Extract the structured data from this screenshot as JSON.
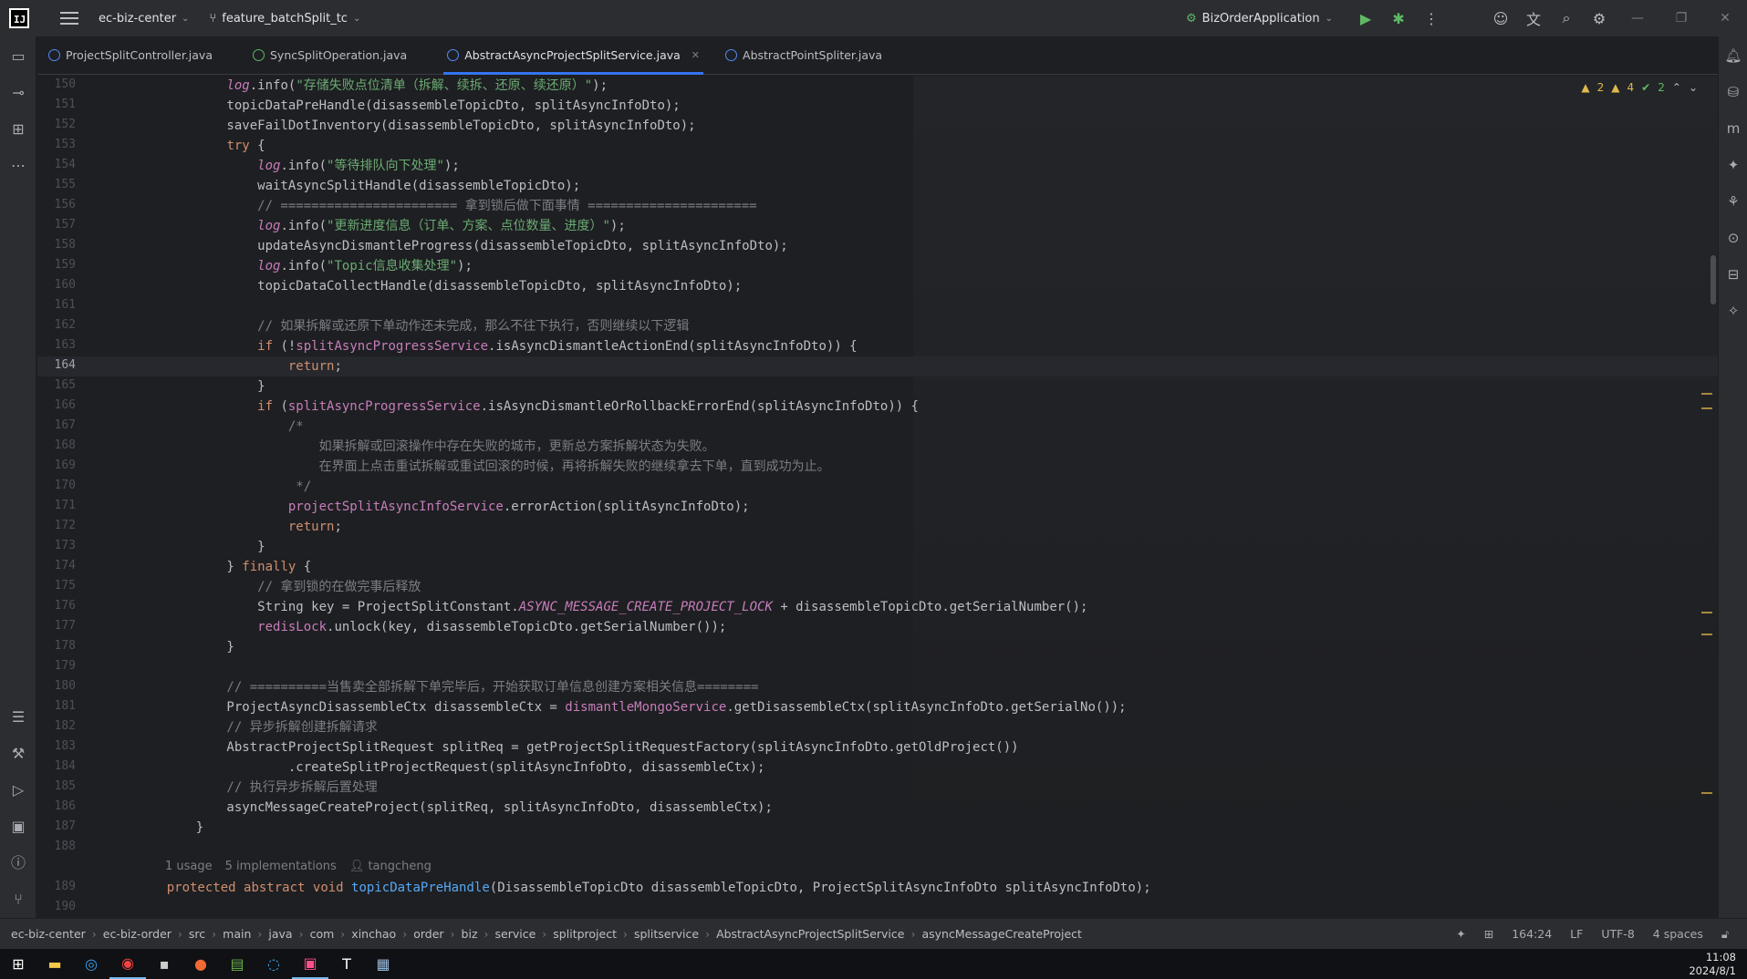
{
  "titlebar": {
    "logo": "IJ",
    "project": "ec-biz-center",
    "branch": "feature_batchSplit_tc",
    "run_config": "BizOrderApplication"
  },
  "tabs": [
    {
      "label": "ProjectSplitController.java",
      "icon": "class-icon"
    },
    {
      "label": "SyncSplitOperation.java",
      "icon": "interface-icon"
    },
    {
      "label": "AbstractAsyncProjectSplitService.java",
      "icon": "class-icon",
      "active": true
    },
    {
      "label": "AbstractPointSpliter.java",
      "icon": "class-icon"
    }
  ],
  "inspections": {
    "warnings": "2",
    "weak_warnings": "4",
    "ok": "2"
  },
  "editor": {
    "current_line": "164",
    "lines": [
      {
        "n": "150",
        "text": "        log.info(\"存储失败点位清单（拆解、续拆、还原、续还原）\");"
      },
      {
        "n": "151",
        "text": "        topicDataPreHandle(disassembleTopicDto, splitAsyncInfoDto);"
      },
      {
        "n": "152",
        "text": "        saveFailDotInventory(disassembleTopicDto, splitAsyncInfoDto);"
      },
      {
        "n": "153",
        "text": "        try {"
      },
      {
        "n": "154",
        "text": "            log.info(\"等待排队向下处理\");"
      },
      {
        "n": "155",
        "text": "            waitAsyncSplitHandle(disassembleTopicDto);"
      },
      {
        "n": "156",
        "text": "            // ======================= 拿到锁后做下面事情 ======================"
      },
      {
        "n": "157",
        "text": "            log.info(\"更新进度信息（订单、方案、点位数量、进度）\");"
      },
      {
        "n": "158",
        "text": "            updateAsyncDismantleProgress(disassembleTopicDto, splitAsyncInfoDto);"
      },
      {
        "n": "159",
        "text": "            log.info(\"Topic信息收集处理\");"
      },
      {
        "n": "160",
        "text": "            topicDataCollectHandle(disassembleTopicDto, splitAsyncInfoDto);"
      },
      {
        "n": "161",
        "text": ""
      },
      {
        "n": "162",
        "text": "            // 如果拆解或还原下单动作还未完成，那么不往下执行，否则继续以下逻辑"
      },
      {
        "n": "163",
        "text": "            if (!splitAsyncProgressService.isAsyncDismantleActionEnd(splitAsyncInfoDto)) {"
      },
      {
        "n": "164",
        "text": "                return;"
      },
      {
        "n": "165",
        "text": "            }"
      },
      {
        "n": "166",
        "text": "            if (splitAsyncProgressService.isAsyncDismantleOrRollbackErrorEnd(splitAsyncInfoDto)) {"
      },
      {
        "n": "167",
        "text": "                /*"
      },
      {
        "n": "168",
        "text": "                    如果拆解或回滚操作中存在失败的城市，更新总方案拆解状态为失败。"
      },
      {
        "n": "169",
        "text": "                    在界面上点击重试拆解或重试回滚的时候，再将拆解失败的继续拿去下单，直到成功为止。"
      },
      {
        "n": "170",
        "text": "                 */"
      },
      {
        "n": "171",
        "text": "                projectSplitAsyncInfoService.errorAction(splitAsyncInfoDto);"
      },
      {
        "n": "172",
        "text": "                return;"
      },
      {
        "n": "173",
        "text": "            }"
      },
      {
        "n": "174",
        "text": "        } finally {"
      },
      {
        "n": "175",
        "text": "            // 拿到锁的在做完事后释放"
      },
      {
        "n": "176",
        "text": "            String key = ProjectSplitConstant.ASYNC_MESSAGE_CREATE_PROJECT_LOCK + disassembleTopicDto.getSerialNumber();"
      },
      {
        "n": "177",
        "text": "            redisLock.unlock(key, disassembleTopicDto.getSerialNumber());"
      },
      {
        "n": "178",
        "text": "        }"
      },
      {
        "n": "179",
        "text": ""
      },
      {
        "n": "180",
        "text": "        // ==========当售卖全部拆解下单完毕后，开始获取订单信息创建方案相关信息========"
      },
      {
        "n": "181",
        "text": "        ProjectAsyncDisassembleCtx disassembleCtx = dismantleMongoService.getDisassembleCtx(splitAsyncInfoDto.getSerialNo());"
      },
      {
        "n": "182",
        "text": "        // 异步拆解创建拆解请求"
      },
      {
        "n": "183",
        "text": "        AbstractProjectSplitRequest splitReq = getProjectSplitRequestFactory(splitAsyncInfoDto.getOldProject())"
      },
      {
        "n": "184",
        "text": "                .createSplitProjectRequest(splitAsyncInfoDto, disassembleCtx);"
      },
      {
        "n": "185",
        "text": "        // 执行异步拆解后置处理"
      },
      {
        "n": "186",
        "text": "        asyncMessageCreateProject(splitReq, splitAsyncInfoDto, disassembleCtx);"
      },
      {
        "n": "187",
        "text": "    }"
      },
      {
        "n": "188",
        "text": ""
      }
    ],
    "hint": {
      "usages": "1 usage",
      "implementations": "5 implementations",
      "author": "tangcheng"
    },
    "tail_lines": [
      {
        "n": "189",
        "text": "    protected abstract void topicDataPreHandle(DisassembleTopicDto disassembleTopicDto, ProjectSplitAsyncInfoDto splitAsyncInfoDto);"
      },
      {
        "n": "190",
        "text": ""
      }
    ]
  },
  "statusbar": {
    "breadcrumbs": [
      "ec-biz-center",
      "ec-biz-order",
      "src",
      "main",
      "java",
      "com",
      "xinchao",
      "order",
      "biz",
      "service",
      "splitproject",
      "splitservice",
      "AbstractAsyncProjectSplitService",
      "asyncMessageCreateProject"
    ],
    "position": "164:24",
    "line_sep": "LF",
    "encoding": "UTF-8",
    "indent": "4 spaces"
  },
  "taskbar": {
    "time": "11:08",
    "date": "2024/8/1"
  }
}
